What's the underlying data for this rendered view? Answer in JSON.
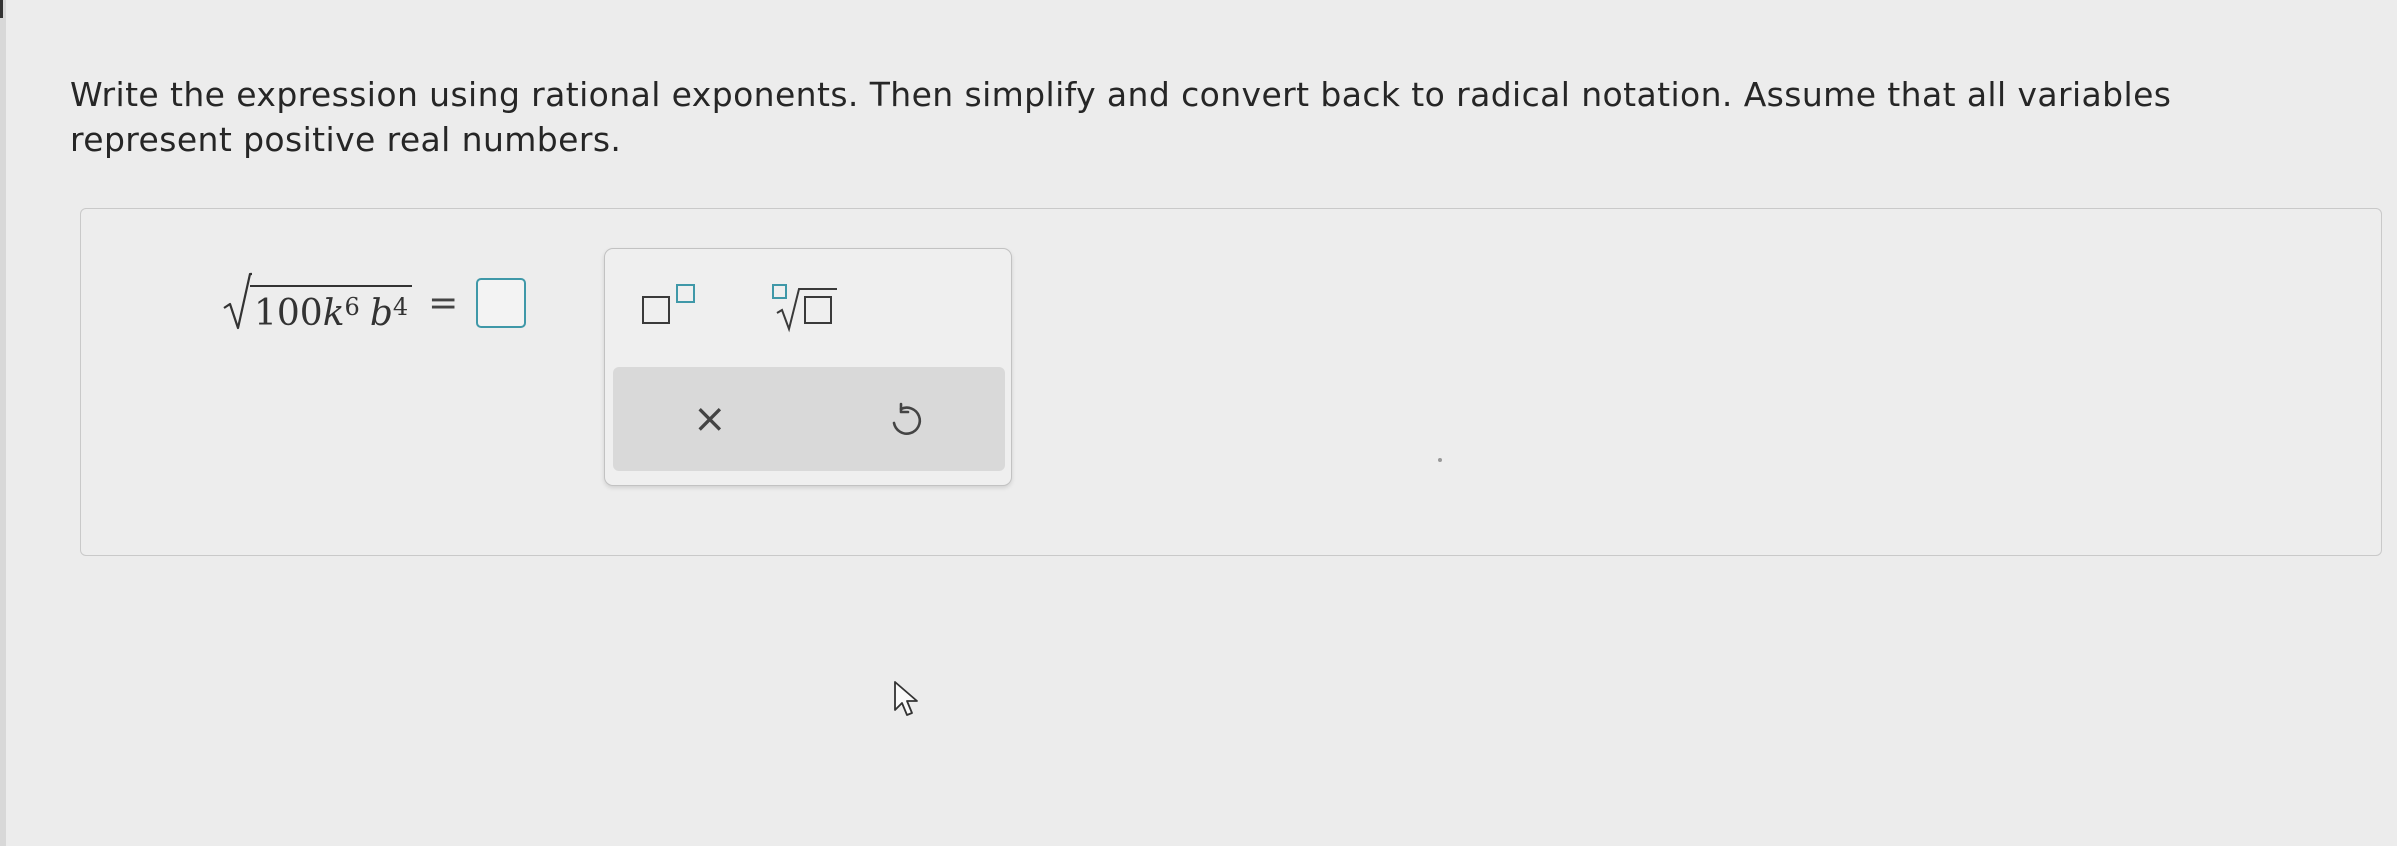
{
  "question": {
    "text": "Write the expression using rational exponents. Then simplify and convert back to radical notation. Assume that all variables represent positive real numbers."
  },
  "expression": {
    "coefficient": "100",
    "var1": "k",
    "exp1": "6",
    "var2": "b",
    "exp2": "4",
    "equals": "="
  },
  "answer": {
    "value": ""
  },
  "palette": {
    "buttons": [
      {
        "icon": "exponent-template-icon"
      },
      {
        "icon": "nth-root-template-icon"
      }
    ],
    "actions": {
      "clear_glyph": "×",
      "undo_icon": "undo-icon"
    },
    "accent_color": "#3f98a8"
  }
}
